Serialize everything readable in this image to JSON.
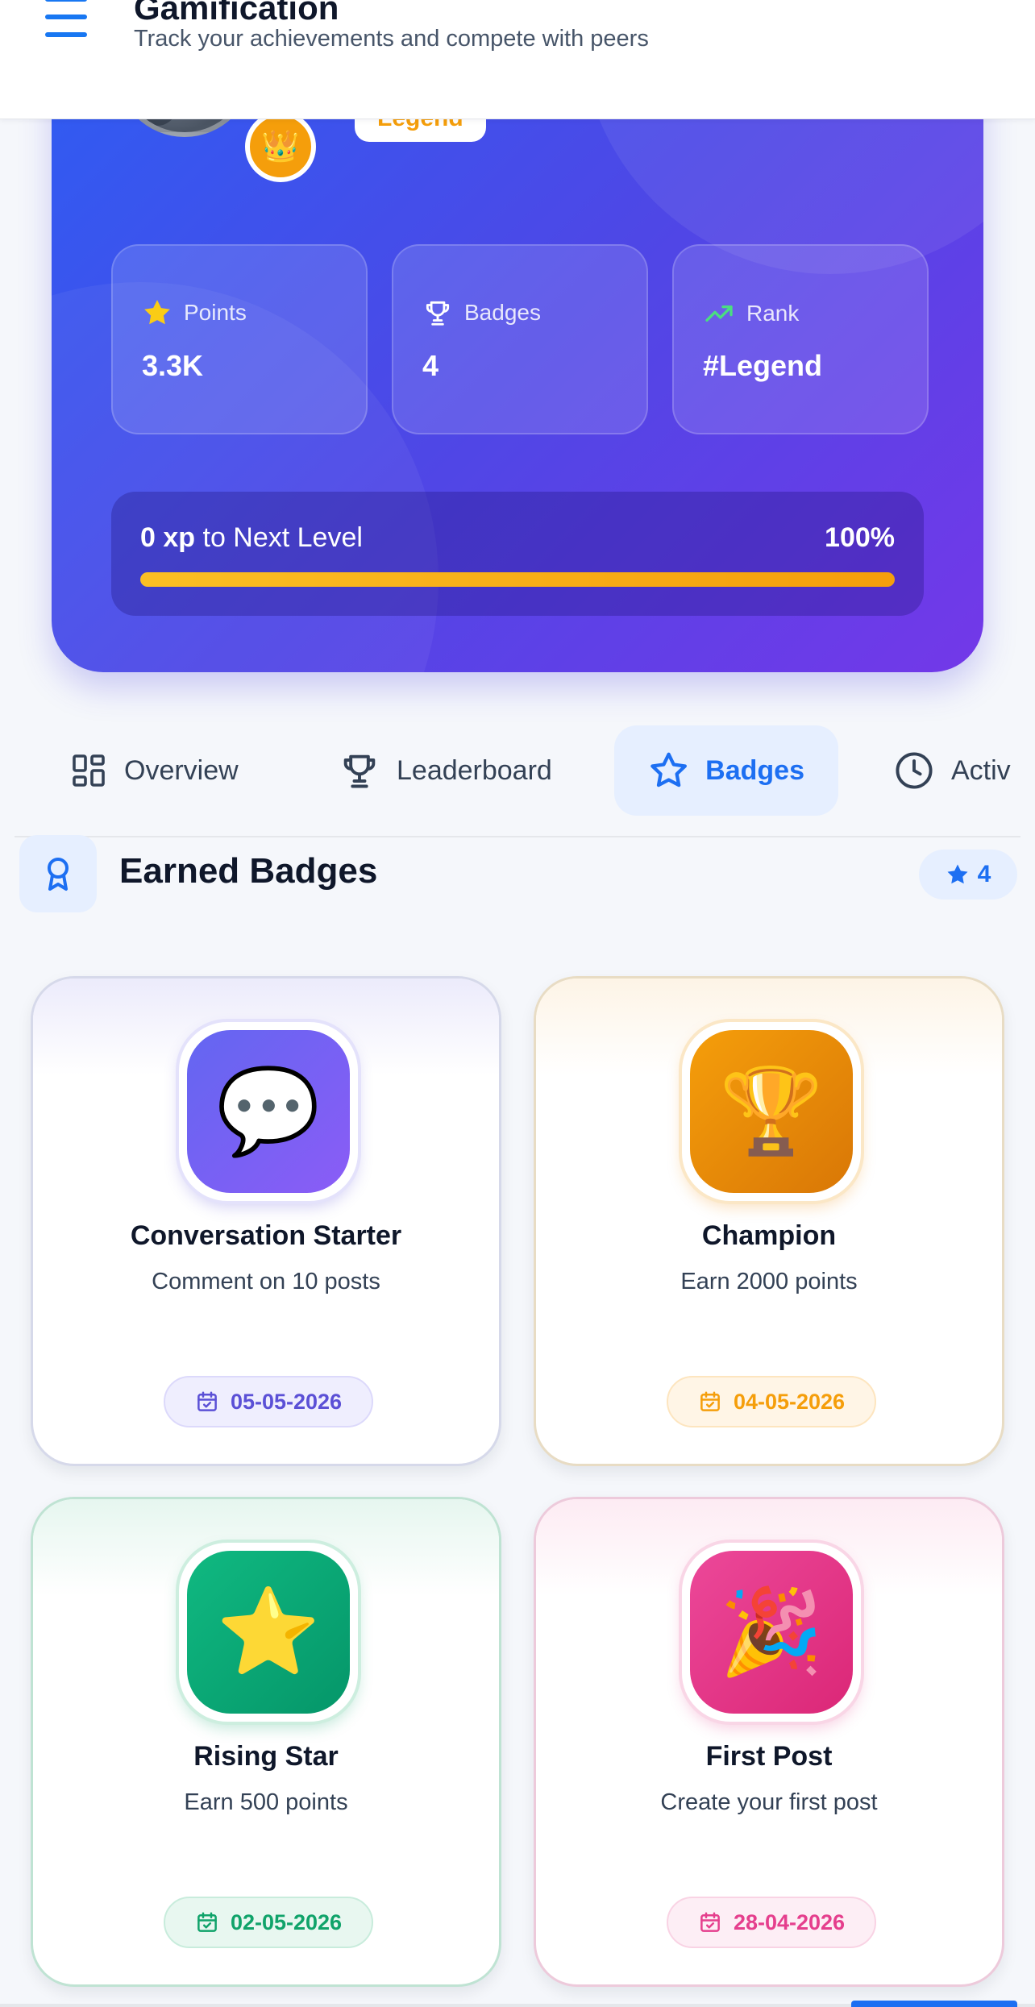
{
  "header": {
    "title": "Gamification",
    "subtitle": "Track your achievements and compete with peers"
  },
  "profile": {
    "level_label": "Legend",
    "crown_emoji": "👑"
  },
  "stats": [
    {
      "label": "Points",
      "value": "3.3K",
      "icon": "star-icon"
    },
    {
      "label": "Badges",
      "value": "4",
      "icon": "trophy-icon"
    },
    {
      "label": "Rank",
      "value": "#Legend",
      "icon": "trending-up-icon"
    }
  ],
  "progress": {
    "xp_amount": "0 xp",
    "label_suffix": " to Next Level",
    "percent_label": "100%",
    "percent": 100
  },
  "tabs": [
    {
      "label": "Overview",
      "icon": "grid-icon",
      "active": false
    },
    {
      "label": "Leaderboard",
      "icon": "trophy-icon",
      "active": false
    },
    {
      "label": "Badges",
      "icon": "star-icon",
      "active": true
    },
    {
      "label": "Activ",
      "icon": "clock-icon",
      "active": false
    }
  ],
  "section": {
    "title": "Earned Badges",
    "count": "4"
  },
  "badges": [
    {
      "name": "Conversation Starter",
      "description": "Comment on 10 posts",
      "date": "05-05-2026",
      "emoji": "💬",
      "color": "#6d5cf0",
      "tint": "#ecebfb",
      "date_color": "#5b50d6",
      "date_bg": "#efeefe"
    },
    {
      "name": "Champion",
      "description": "Earn 2000 points",
      "date": "04-05-2026",
      "emoji": "🏆",
      "color": "#f08c0a",
      "tint": "#fdf4e6",
      "date_color": "#f59e0b",
      "date_bg": "#fff5e6"
    },
    {
      "name": "Rising Star",
      "description": "Earn 500 points",
      "date": "02-05-2026",
      "emoji": "⭐",
      "color": "#10a36a",
      "tint": "#e6f6ef",
      "date_color": "#10a36a",
      "date_bg": "#e8f7f0"
    },
    {
      "name": "First Post",
      "description": "Create your first post",
      "date": "28-04-2026",
      "emoji": "🎉",
      "color": "#e53f8d",
      "tint": "#fdebf3",
      "date_color": "#e53f8d",
      "date_bg": "#fdeef5"
    }
  ],
  "colors": {
    "accent": "#1d6ff2",
    "hero_start": "#2f5cf2",
    "hero_end": "#7338e8",
    "progress": "#fbbf24"
  }
}
